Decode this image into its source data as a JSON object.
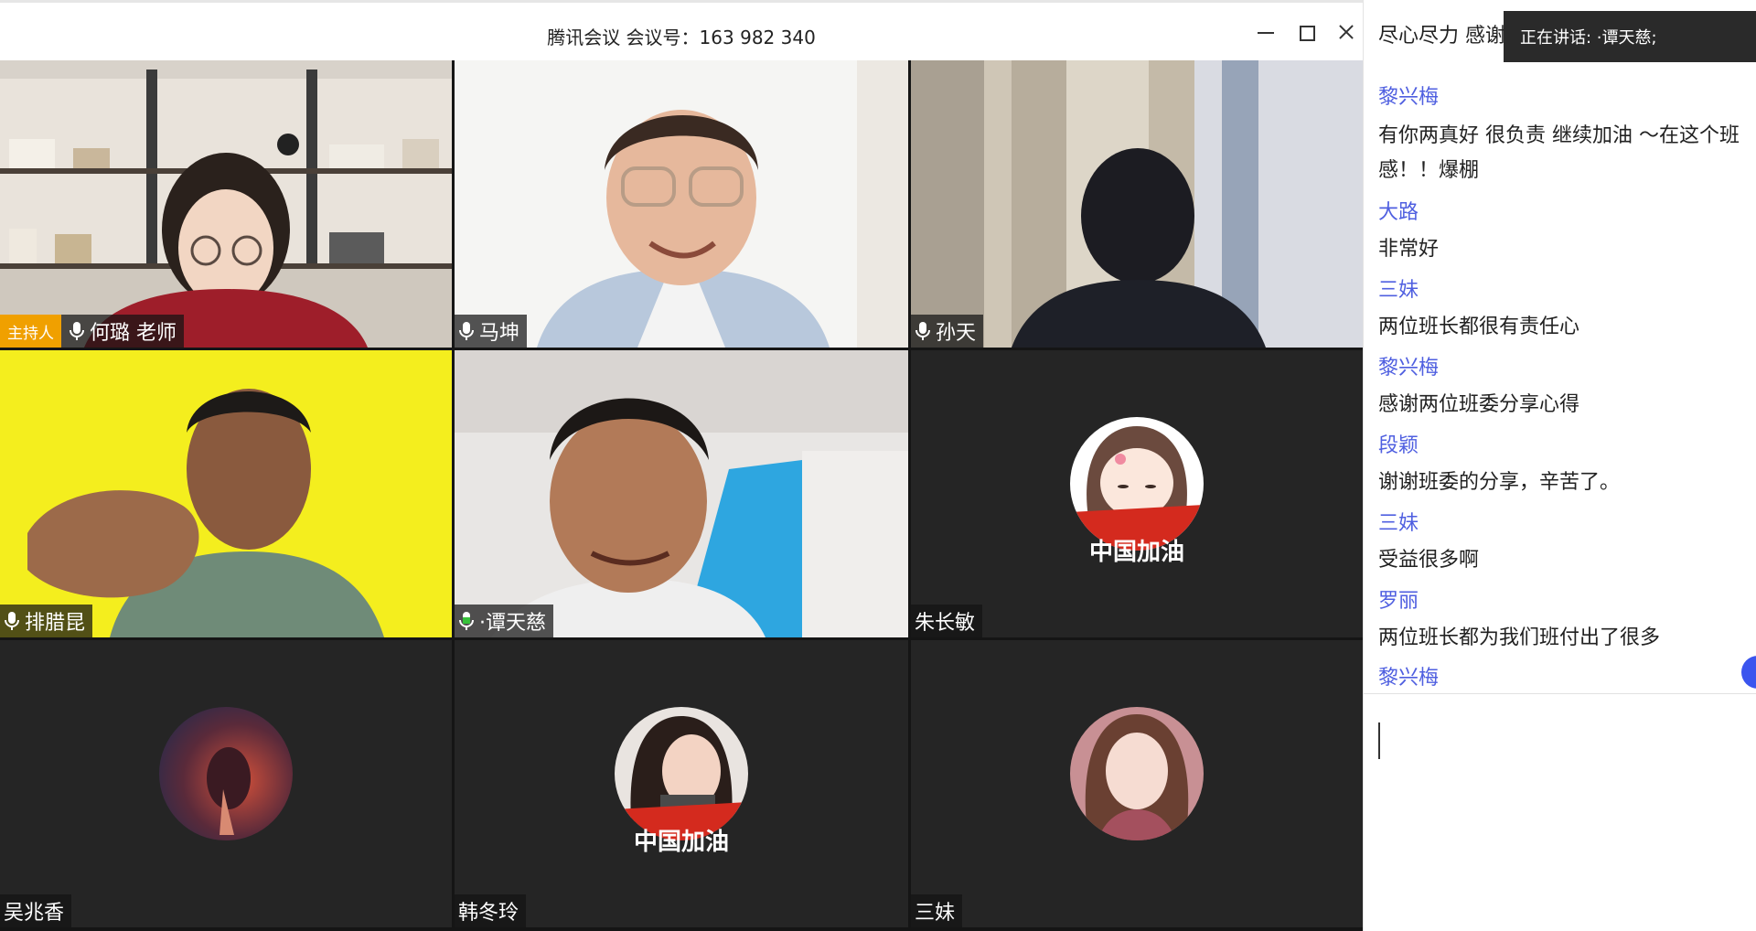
{
  "window": {
    "title": "腾讯会议 会议号：163 982 340"
  },
  "participants": [
    {
      "name": "何璐 老师",
      "host_badge": "主持人",
      "video": "camera",
      "mic": true
    },
    {
      "name": "马坤",
      "video": "camera",
      "mic": true
    },
    {
      "name": "孙天",
      "video": "camera",
      "mic": true
    },
    {
      "name": "排腊昆",
      "video": "camera",
      "mic": true
    },
    {
      "name": "·谭天慈",
      "video": "camera",
      "mic": true,
      "mic_active": true
    },
    {
      "name": "朱长敏",
      "video": "avatar",
      "avatar_text": "中国加油",
      "mic": false
    },
    {
      "name": "吴兆香",
      "video": "avatar",
      "mic": false
    },
    {
      "name": "韩冬玲",
      "video": "avatar",
      "avatar_text": "中国加油",
      "mic": false
    },
    {
      "name": "三妹",
      "video": "avatar",
      "mic": false
    }
  ],
  "chat": {
    "speaking_label": "正在讲话: ·谭天慈;",
    "partial_top_text": "尽心尽力 感谢有你",
    "messages": [
      {
        "sender": "黎兴梅",
        "text": " 有你两真好 很负责 继续加油 ～在这个班",
        "text2": "感！！爆棚"
      },
      {
        "sender": "大路",
        "text": "非常好"
      },
      {
        "sender": "三妹",
        "text": "两位班长都很有责任心"
      },
      {
        "sender": "黎兴梅",
        "text": "感谢两位班委分享心得"
      },
      {
        "sender": "段颖",
        "text": "谢谢班委的分享，辛苦了。"
      },
      {
        "sender": "三妹",
        "text": "受益很多啊"
      },
      {
        "sender": "罗丽",
        "text": "两位班长都为我们班付出了很多"
      },
      {
        "sender": "黎兴梅",
        "text": ""
      }
    ]
  },
  "colors": {
    "sender_name": "#4f5fe0",
    "host_badge": "#f0a000",
    "active_mic": "#37c23b",
    "scroll_badge": "#3b55ee"
  }
}
